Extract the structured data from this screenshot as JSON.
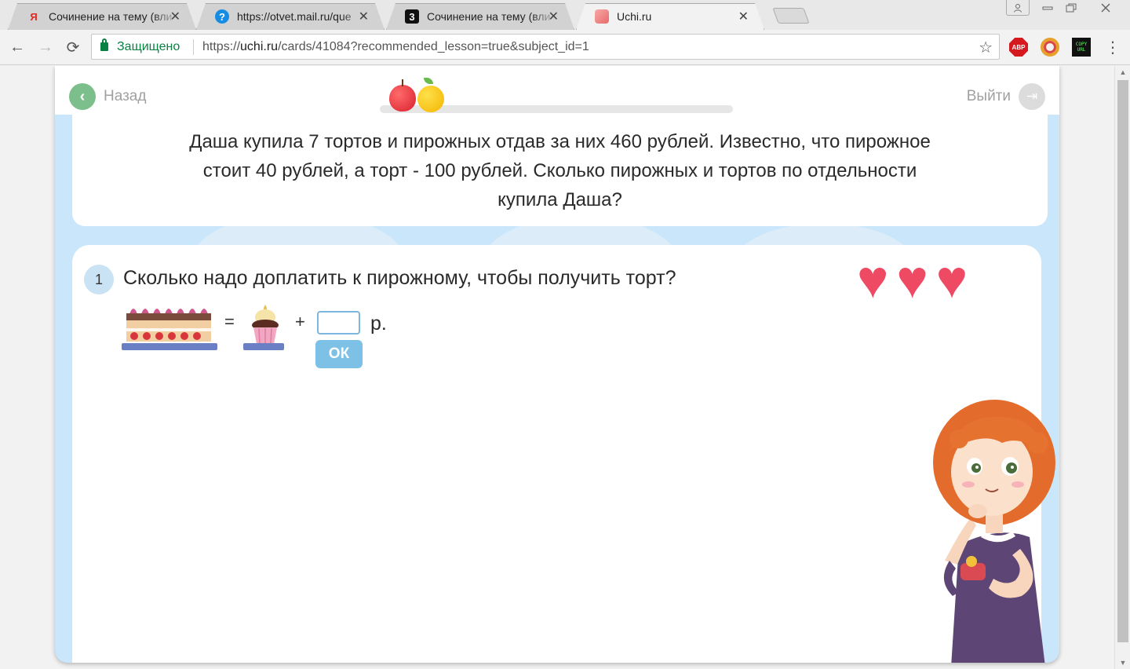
{
  "browser": {
    "tabs": [
      {
        "favicon": "Я",
        "favicon_color": "#e52620",
        "title": "Сочинение на тему (вли",
        "close": "✕"
      },
      {
        "favicon": "?",
        "favicon_color": "#168de2",
        "title": "https://otvet.mail.ru/que",
        "close": "✕"
      },
      {
        "favicon": "3",
        "favicon_color": "#111111",
        "title": "Сочинение на тему (вли",
        "close": "✕"
      },
      {
        "favicon": "",
        "favicon_color": "#e86a6a",
        "title": "Uchi.ru",
        "close": "✕"
      }
    ],
    "active_tab": 3,
    "window_controls": {
      "user": "👤",
      "minimize": "—",
      "restore": "❐",
      "close": "✕"
    },
    "nav": {
      "back": "←",
      "forward": "→",
      "reload": "⟳"
    },
    "address": {
      "secure_label": "Защищено",
      "url_prefix": "https://",
      "url_host": "uchi.ru",
      "url_path": "/cards/41084?recommended_lesson=true&subject_id=1"
    },
    "bookmark_icon": "☆",
    "extensions": [
      {
        "name": "adblock-plus-icon",
        "label": "ABP"
      },
      {
        "name": "extension-ring-icon",
        "label": ""
      },
      {
        "name": "copy-url-icon",
        "label": "COPY URL"
      }
    ],
    "menu_icon": "⋮"
  },
  "page": {
    "header": {
      "back_label": "Назад",
      "back_icon": "‹",
      "exit_label": "Выйти",
      "exit_icon": "⇥"
    },
    "task": {
      "text": "Даша купила 7 тортов и пирожных отдав за них 460 рублей. Известно, что пирожное стоит 40 рублей, а торт - 100 рублей. Сколько пирожных и тортов по отдельности купила Даша?"
    },
    "question": {
      "number": "1",
      "text": "Сколько надо доплатить к пирожному, чтобы получить торт?",
      "lives": 3,
      "equation": {
        "equals": "=",
        "plus": "+",
        "answer_value": "",
        "unit": "р."
      },
      "ok_label": "ОК"
    },
    "colors": {
      "accent_blue": "#7dc1e6",
      "heart": "#ee4a63",
      "back_green": "#7dbf8c",
      "card_bg": "#c9e6fb"
    }
  }
}
